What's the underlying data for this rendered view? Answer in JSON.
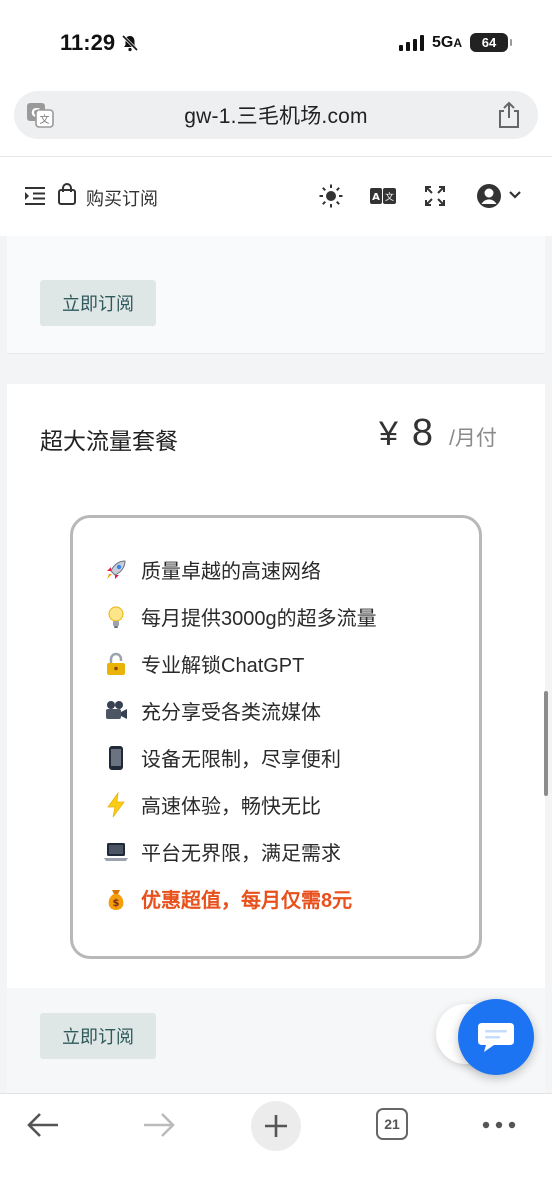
{
  "status_bar": {
    "time": "11:29",
    "network": "5G",
    "network_suffix": "A",
    "battery": "64"
  },
  "browser": {
    "url": "gw-1.三毛机场.com",
    "tabs_count": "21"
  },
  "header": {
    "title": "购买订阅"
  },
  "previous_card": {
    "subscribe_label": "立即订阅"
  },
  "plan": {
    "name": "超大流量套餐",
    "currency": "¥",
    "price": "8",
    "period": "/月付",
    "features": [
      {
        "icon": "rocket-icon",
        "text": "质量卓越的高速网络"
      },
      {
        "icon": "lightbulb-icon",
        "text": "每月提供3000g的超多流量"
      },
      {
        "icon": "lock-icon",
        "text": "专业解锁ChatGPT"
      },
      {
        "icon": "video-camera-icon",
        "text": "充分享受各类流媒体"
      },
      {
        "icon": "mobile-phone-icon",
        "text": "设备无限制，尽享便利"
      },
      {
        "icon": "lightning-icon",
        "text": "高速体验，畅快无比"
      },
      {
        "icon": "laptop-icon",
        "text": "平台无界限，满足需求"
      },
      {
        "icon": "money-bag-icon",
        "text": "优惠超值，每月仅需8元"
      }
    ],
    "subscribe_label": "立即订阅"
  },
  "colors": {
    "highlight": "#e8501c",
    "button_bg": "#dfe6e6",
    "button_text": "#2f5a5c",
    "chat_fab": "#1d74f2"
  }
}
